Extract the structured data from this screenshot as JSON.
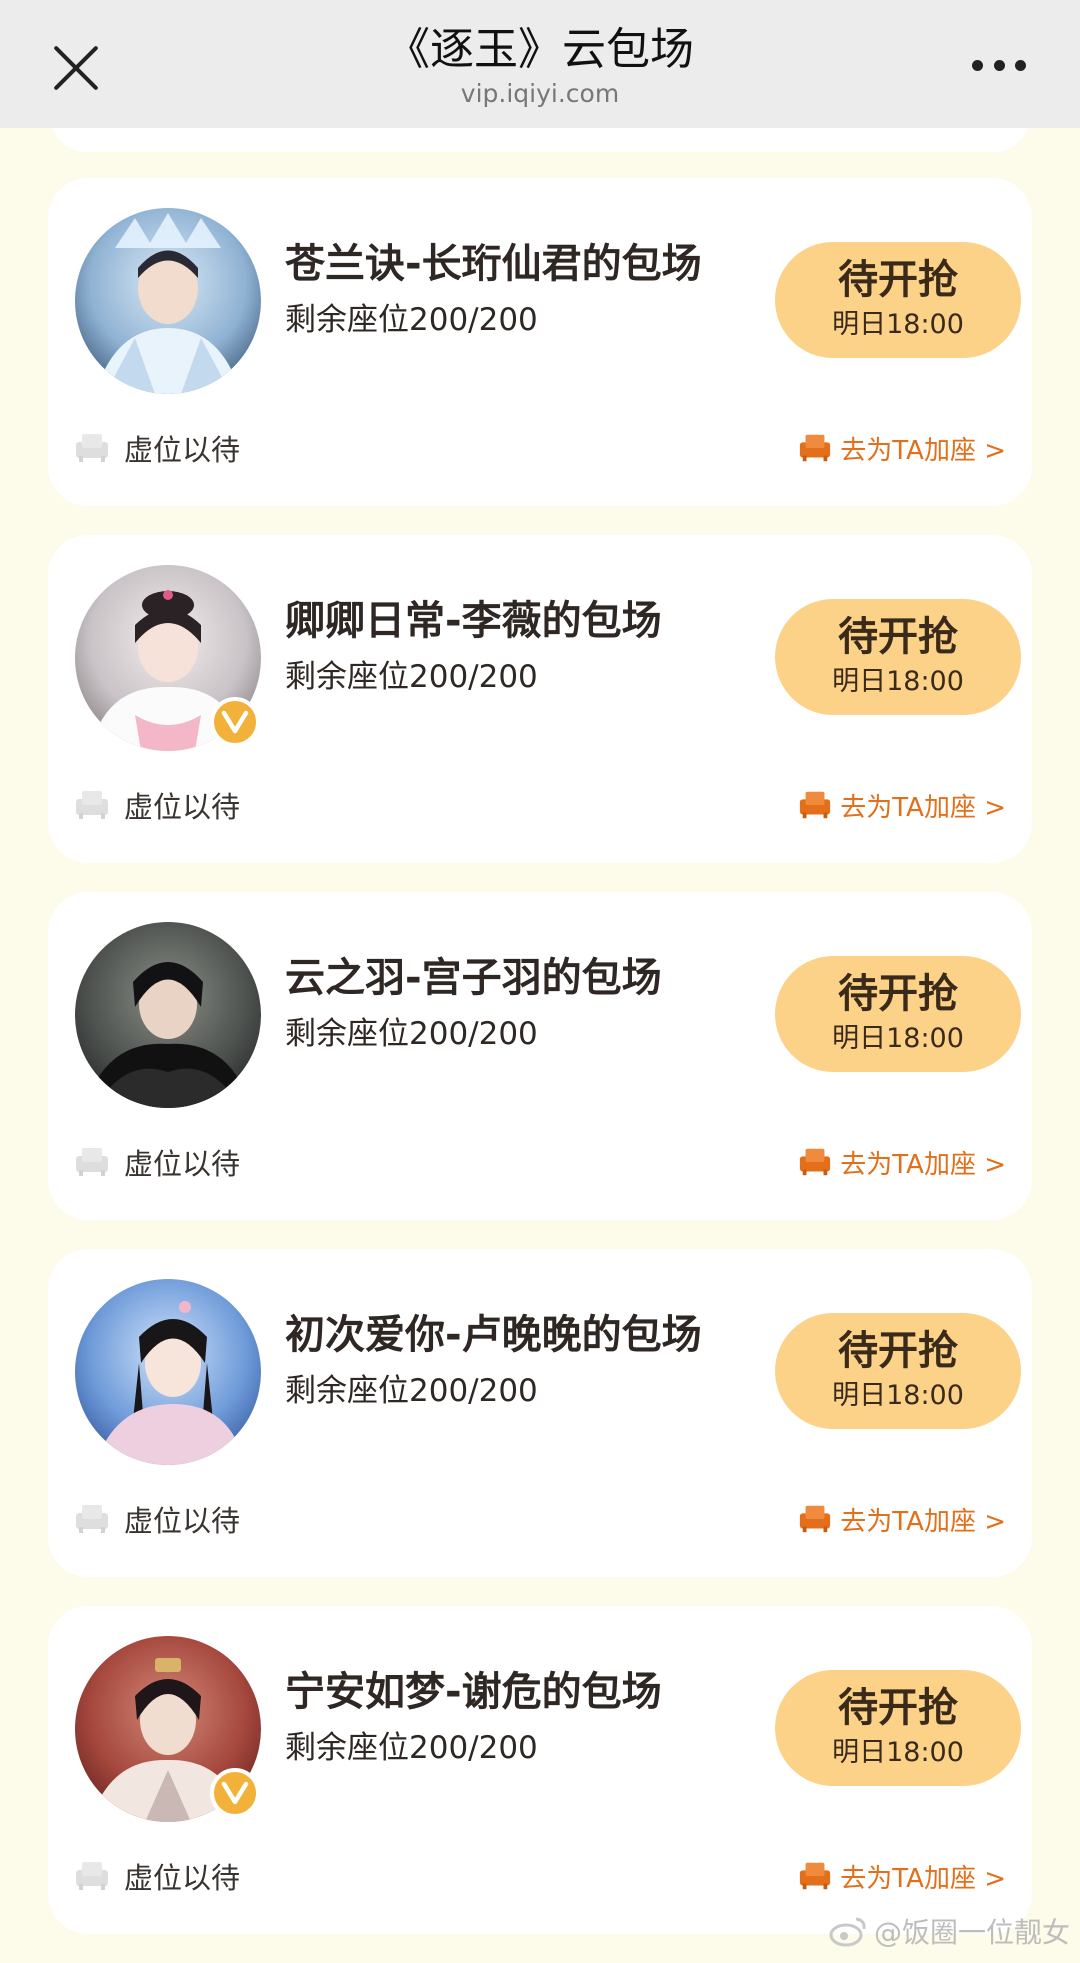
{
  "nav": {
    "title": "《逐玉》云包场",
    "domain": "vip.iqiyi.com"
  },
  "cards": [
    {
      "title": "苍兰诀-长珩仙君的包场",
      "seats": "剩余座位200/200",
      "button_label": "待开抢",
      "button_time": "明日18:00",
      "empty_label": "虚位以待",
      "join_label": "去为TA加座 >",
      "verified": false
    },
    {
      "title": "卿卿日常-李薇的包场",
      "seats": "剩余座位200/200",
      "button_label": "待开抢",
      "button_time": "明日18:00",
      "empty_label": "虚位以待",
      "join_label": "去为TA加座 >",
      "verified": true
    },
    {
      "title": "云之羽-宫子羽的包场",
      "seats": "剩余座位200/200",
      "button_label": "待开抢",
      "button_time": "明日18:00",
      "empty_label": "虚位以待",
      "join_label": "去为TA加座 >",
      "verified": false
    },
    {
      "title": "初次爱你-卢晚晚的包场",
      "seats": "剩余座位200/200",
      "button_label": "待开抢",
      "button_time": "明日18:00",
      "empty_label": "虚位以待",
      "join_label": "去为TA加座 >",
      "verified": false
    },
    {
      "title": "宁安如梦-谢危的包场",
      "seats": "剩余座位200/200",
      "button_label": "待开抢",
      "button_time": "明日18:00",
      "empty_label": "虚位以待",
      "join_label": "去为TA加座 >",
      "verified": true
    }
  ],
  "watermark": "@饭圈一位靓女",
  "colors": {
    "page_bg": "#fdfbea",
    "button_bg": "#fcd289",
    "accent_orange": "#e36f1b",
    "badge_gold": "#f2b23a"
  }
}
